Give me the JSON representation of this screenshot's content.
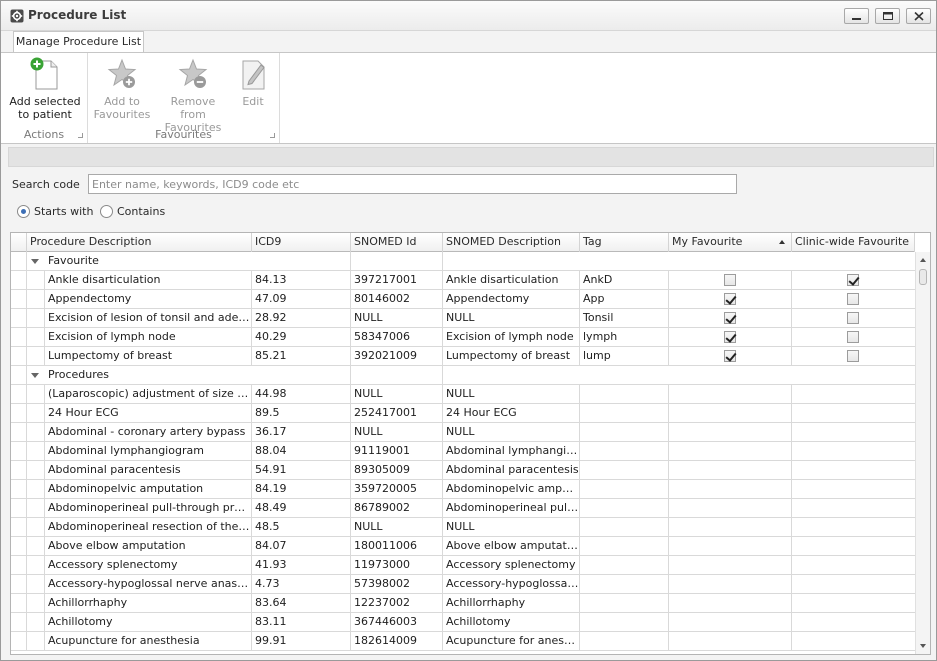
{
  "window": {
    "title": "Procedure List",
    "icon": "gear-icon"
  },
  "ribbon": {
    "tab": "Manage Procedure List",
    "groups": {
      "actions": "Actions",
      "favourites": "Favourites"
    },
    "buttons": {
      "add_to_patient_line1": "Add selected",
      "add_to_patient_line2": "to patient",
      "add_fav_line1": "Add to",
      "add_fav_line2": "Favourites",
      "remove_fav_line1": "Remove from",
      "remove_fav_line2": "Favourites",
      "edit": "Edit"
    }
  },
  "search": {
    "label": "Search code",
    "value": "",
    "placeholder": "Enter name, keywords, ICD9 code etc",
    "modes": [
      {
        "label": "Starts with",
        "selected": true
      },
      {
        "label": "Contains",
        "selected": false
      }
    ]
  },
  "grid": {
    "columns": [
      "Procedure Description",
      "ICD9",
      "SNOMED Id",
      "SNOMED Description",
      "Tag",
      "My Favourite",
      "Clinic-wide Favourite"
    ],
    "sorted_column": "My Favourite",
    "sort_direction": "ascending",
    "groups": [
      {
        "name": "Favourite",
        "rows": [
          {
            "desc": "Ankle disarticulation",
            "icd9": "84.13",
            "snomed_id": "397217001",
            "snomed_desc": "Ankle disarticulation",
            "tag": "AnkD",
            "my_fav": false,
            "clinic_fav": true
          },
          {
            "desc": "Appendectomy",
            "icd9": "47.09",
            "snomed_id": "80146002",
            "snomed_desc": "Appendectomy",
            "tag": "App",
            "my_fav": true,
            "clinic_fav": false
          },
          {
            "desc": "Excision of lesion of tonsil and ade…",
            "icd9": "28.92",
            "snomed_id": "NULL",
            "snomed_desc": "NULL",
            "tag": "Tonsil",
            "my_fav": true,
            "clinic_fav": false
          },
          {
            "desc": "Excision of lymph node",
            "icd9": "40.29",
            "snomed_id": "58347006",
            "snomed_desc": "Excision of lymph node",
            "tag": "lymph",
            "my_fav": true,
            "clinic_fav": false
          },
          {
            "desc": "Lumpectomy of breast",
            "icd9": "85.21",
            "snomed_id": "392021009",
            "snomed_desc": "Lumpectomy of breast",
            "tag": "lump",
            "my_fav": true,
            "clinic_fav": false
          }
        ]
      },
      {
        "name": "Procedures",
        "rows": [
          {
            "desc": "(Laparoscopic) adjustment of size …",
            "icd9": "44.98",
            "snomed_id": "NULL",
            "snomed_desc": "NULL",
            "tag": ""
          },
          {
            "desc": "24 Hour ECG",
            "icd9": "89.5",
            "snomed_id": "252417001",
            "snomed_desc": "24 Hour ECG",
            "tag": ""
          },
          {
            "desc": "Abdominal - coronary artery bypass",
            "icd9": "36.17",
            "snomed_id": "NULL",
            "snomed_desc": "NULL",
            "tag": ""
          },
          {
            "desc": "Abdominal lymphangiogram",
            "icd9": "88.04",
            "snomed_id": "91119001",
            "snomed_desc": "Abdominal lymphangiogr…",
            "tag": ""
          },
          {
            "desc": "Abdominal paracentesis",
            "icd9": "54.91",
            "snomed_id": "89305009",
            "snomed_desc": "Abdominal paracentesis",
            "tag": ""
          },
          {
            "desc": "Abdominopelvic amputation",
            "icd9": "84.19",
            "snomed_id": "359720005",
            "snomed_desc": "Abdominopelvic amputat…",
            "tag": ""
          },
          {
            "desc": "Abdominoperineal pull-through pro…",
            "icd9": "48.49",
            "snomed_id": "86789002",
            "snomed_desc": "Abdominoperineal pull-t…",
            "tag": ""
          },
          {
            "desc": "Abdominoperineal resection of the …",
            "icd9": "48.5",
            "snomed_id": "NULL",
            "snomed_desc": "NULL",
            "tag": ""
          },
          {
            "desc": "Above elbow amputation",
            "icd9": "84.07",
            "snomed_id": "180011006",
            "snomed_desc": "Above elbow amputation",
            "tag": ""
          },
          {
            "desc": "Accessory splenectomy",
            "icd9": "41.93",
            "snomed_id": "11973000",
            "snomed_desc": "Accessory splenectomy",
            "tag": ""
          },
          {
            "desc": "Accessory-hypoglossal nerve anas…",
            "icd9": "4.73",
            "snomed_id": "57398002",
            "snomed_desc": "Accessory-hypoglossal …",
            "tag": ""
          },
          {
            "desc": "Achillorrhaphy",
            "icd9": "83.64",
            "snomed_id": "12237002",
            "snomed_desc": "Achillorrhaphy",
            "tag": ""
          },
          {
            "desc": "Achillotomy",
            "icd9": "83.11",
            "snomed_id": "367446003",
            "snomed_desc": "Achillotomy",
            "tag": ""
          },
          {
            "desc": "Acupuncture for anesthesia",
            "icd9": "99.91",
            "snomed_id": "182614009",
            "snomed_desc": "Acupuncture for anesth…",
            "tag": ""
          }
        ]
      }
    ]
  },
  "colors": {
    "accent": "#3d6fb6",
    "ribbon_bg": "#ffffff",
    "frame_bg": "#f3f3f3"
  }
}
